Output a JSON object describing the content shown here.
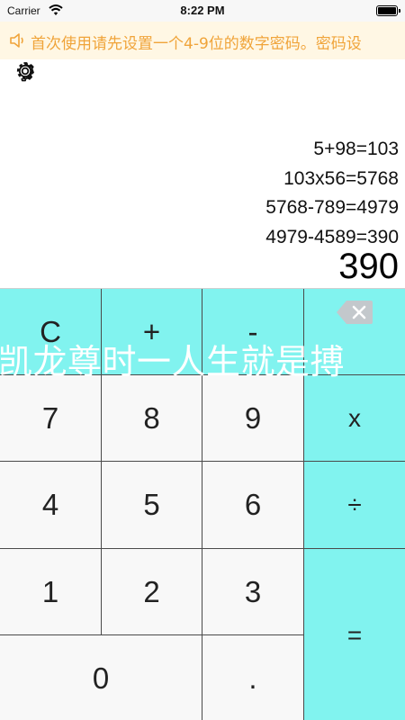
{
  "status_bar": {
    "carrier": "Carrier",
    "time": "8:22 PM",
    "icons": [
      "wifi-icon",
      "battery-icon"
    ]
  },
  "notice": {
    "icon": "speaker-icon",
    "text": "首次使用请先设置一个4-9位的数字密码。密码设"
  },
  "settings": {
    "icon": "gear-icon"
  },
  "history": {
    "lines": [
      "5+98=103",
      "103x56=5768",
      "5768-789=4979",
      "4979-4589=390"
    ],
    "result": "390"
  },
  "keypad": {
    "clear": "C",
    "plus": "+",
    "minus": "-",
    "backspace_icon": "backspace-icon",
    "seven": "7",
    "eight": "8",
    "nine": "9",
    "multiply": "x",
    "four": "4",
    "five": "5",
    "six": "6",
    "divide": "÷",
    "one": "1",
    "two": "2",
    "three": "3",
    "equals": "=",
    "zero": "0",
    "dot": "."
  },
  "watermark": "凯龙尊时一人生就是搏",
  "colors": {
    "accent": "#81f3ef",
    "notice_bg": "#fff7e4",
    "notice_text": "#f0a43a",
    "key_bg": "#f8f8f8"
  }
}
